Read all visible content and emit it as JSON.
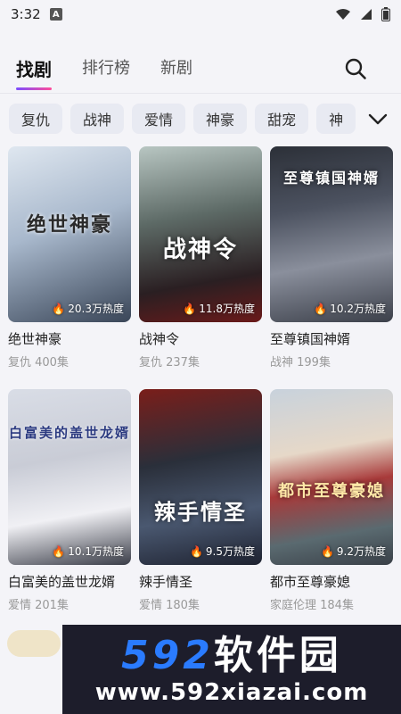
{
  "status": {
    "time": "3:32",
    "a_badge": "A"
  },
  "tabs": [
    {
      "label": "找剧"
    },
    {
      "label": "排行榜"
    },
    {
      "label": "新剧"
    }
  ],
  "chips": [
    "复仇",
    "战神",
    "爱情",
    "神豪",
    "甜宠",
    "神"
  ],
  "colors": {
    "accent_start": "#7b4dff",
    "accent_end": "#ff4d9a",
    "watermark_blue": "#2a7bff"
  },
  "dramas": [
    {
      "title": "绝世神豪",
      "meta": "复仇 400集",
      "heat": "20.3万热度",
      "cover_text": "绝世神豪"
    },
    {
      "title": "战神令",
      "meta": "复仇 237集",
      "heat": "11.8万热度",
      "cover_text": "战神令"
    },
    {
      "title": "至尊镇国神婿",
      "meta": "战神 199集",
      "heat": "10.2万热度",
      "cover_text": "至尊镇国神婿"
    },
    {
      "title": "白富美的盖世龙婿",
      "meta": "爱情 201集",
      "heat": "10.1万热度",
      "cover_text": "白富美的盖世龙婿"
    },
    {
      "title": "辣手情圣",
      "meta": "爱情 180集",
      "heat": "9.5万热度",
      "cover_text": "辣手情圣"
    },
    {
      "title": "都市至尊豪媳",
      "meta": "家庭伦理 184集",
      "heat": "9.2万热度",
      "cover_text": "都市至尊豪媳"
    }
  ],
  "watermark": {
    "brand_num": "592",
    "brand_cn": "软件园",
    "url": "www.592xiazai.com"
  }
}
